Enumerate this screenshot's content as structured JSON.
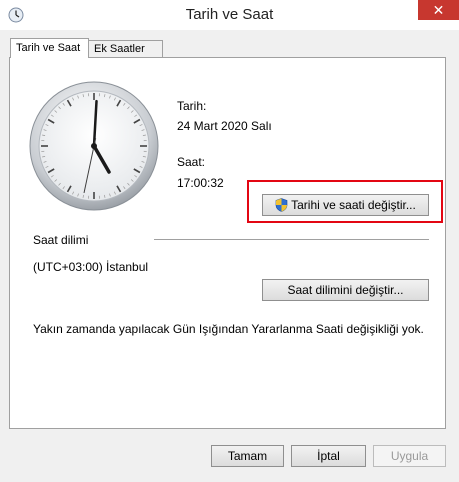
{
  "window": {
    "title": "Tarih ve Saat",
    "close_glyph": "✕"
  },
  "tabs": [
    {
      "label": "Tarih ve Saat",
      "active": true
    },
    {
      "label": "Ek Saatler",
      "active": false
    }
  ],
  "clock": {
    "hour": 17,
    "minute": 0,
    "second": 32
  },
  "date": {
    "label": "Tarih:",
    "value": "24 Mart 2020 Salı"
  },
  "time": {
    "label": "Saat:",
    "value": "17:00:32"
  },
  "change_datetime_button": "Tarihi ve saati değiştir...",
  "timezone": {
    "heading": "Saat dilimi",
    "value": "(UTC+03:00) İstanbul",
    "change_button": "Saat dilimini değiştir..."
  },
  "dst_message": "Yakın zamanda yapılacak Gün Işığından Yararlanma Saati değişikliği yok.",
  "footer": {
    "ok": "Tamam",
    "cancel": "İptal",
    "apply": "Uygula"
  },
  "colors": {
    "highlight": "#e30613",
    "close_button": "#c7372f"
  }
}
